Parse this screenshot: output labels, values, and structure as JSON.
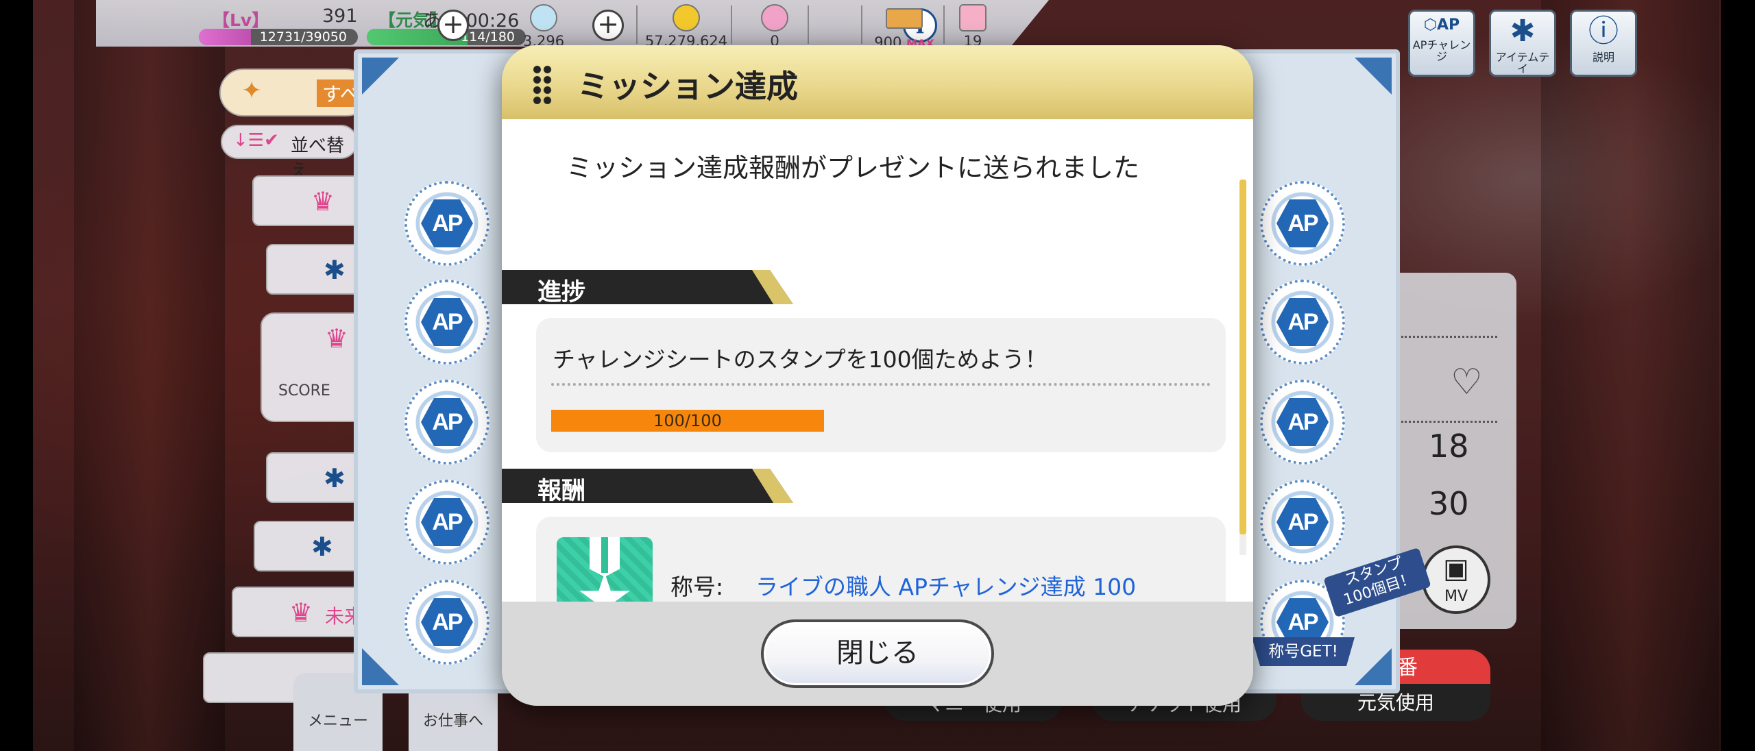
{
  "status": {
    "lv_label": "【Lv】",
    "lv_value": "391",
    "exp": "12731/39050",
    "exp_fraction": 0.326,
    "stamina_label": "【元気】",
    "stamina_time": "あと 00:26",
    "stamina": "114/180",
    "stamina_fraction": 0.633,
    "gems": "3,296",
    "coins": "57,279,624",
    "pink_items": "0",
    "ap_value": "900",
    "ap_max_label": "MAX",
    "tickets": "19"
  },
  "side_buttons": {
    "ap_challenge": "APチャレンジ",
    "item": "アイテムテイ",
    "help": "説明"
  },
  "background_list": {
    "filter_label": "すべ",
    "sort_label": "並べ替え",
    "score_label": "SCORE",
    "item_text": "未来"
  },
  "right_panel": {
    "value_1": "18",
    "value_2": "30",
    "mv_label": "MV"
  },
  "stamp_badge": {
    "line1": "スタンプ",
    "line2": "100個目！",
    "get_label": "称号GET!"
  },
  "bottom_nav": {
    "menu_label": "メニュー",
    "work_label": "お仕事へ",
    "btn1": "マニー使用",
    "btn2": "チケット使用",
    "btn3": "元気使用",
    "btn3_top": "番"
  },
  "dialog": {
    "title": "ミッション達成",
    "message": "ミッション達成報酬がプレゼントに送られました",
    "progress_section": "進捗",
    "mission_text": "チャレンジシートのスタンプを100個ためよう！",
    "progress_text": "100/100",
    "progress_fraction": 1.0,
    "reward_section": "報酬",
    "reward_prefix": "称号:",
    "reward_name": "ライブの職人 APチャレンジ達成 100",
    "close_label": "閉じる"
  },
  "stamp_text": "AP",
  "colors": {
    "accent_gold": "#e9c64d",
    "progress_orange": "#f7870c",
    "reward_blue": "#1f64d8",
    "stamp_blue": "#2368b7"
  }
}
